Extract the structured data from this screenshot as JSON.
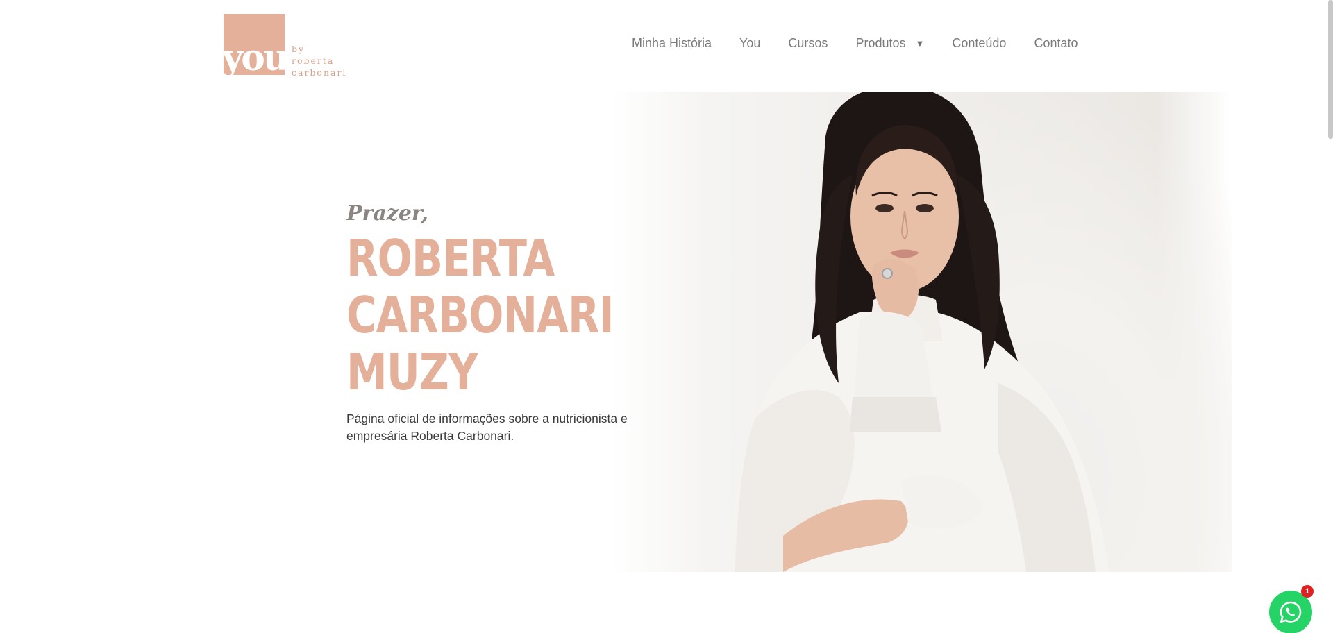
{
  "logo": {
    "word": "you",
    "by": "by",
    "line1": "roberta",
    "line2": "carbonari"
  },
  "nav": {
    "items": [
      "Minha História",
      "You",
      "Cursos",
      "Produtos",
      "Conteúdo",
      "Contato"
    ]
  },
  "hero": {
    "greeting": "Prazer,",
    "name_lines": [
      "ROBERTA",
      "CARBONARI",
      "MUZY"
    ],
    "description": "Página oficial de informações sobre a nutricionista e empresária Roberta Carbonari."
  },
  "whatsapp": {
    "badge": "1"
  },
  "colors": {
    "accent": "#e4b09a",
    "whatsapp": "#25d366"
  }
}
